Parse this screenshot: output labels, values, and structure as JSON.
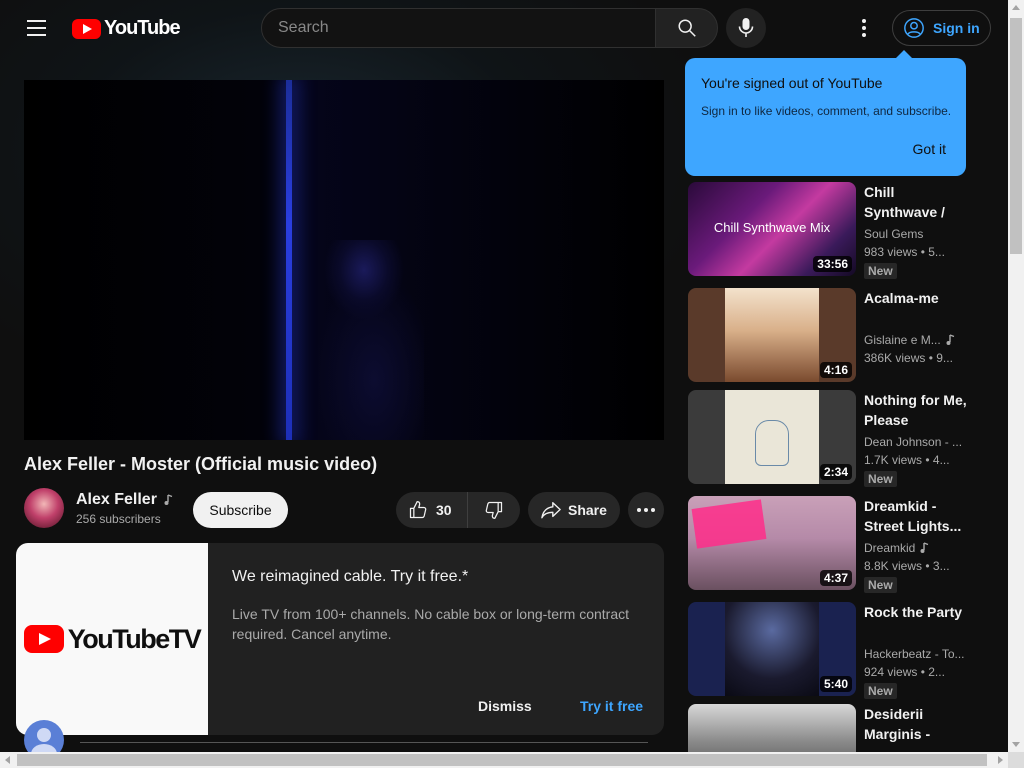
{
  "header": {
    "logo_text": "YouTube",
    "search_placeholder": "Search",
    "signin_label": "Sign in"
  },
  "video": {
    "title": "Alex Feller - Moster (Official music video)",
    "channel": "Alex Feller",
    "subscribers": "256 subscribers",
    "subscribe_label": "Subscribe",
    "likes": "30",
    "share_label": "Share"
  },
  "ad": {
    "brand": "YouTubeTV",
    "title": "We reimagined cable. Try it free.*",
    "description": "Live TV from 100+ channels. No cable box or long-term contract required. Cancel anytime.",
    "dismiss_label": "Dismiss",
    "cta_label": "Try it free"
  },
  "tooltip": {
    "title": "You're signed out of YouTube",
    "body": "Sign in to like videos, comment, and subscribe.",
    "button": "Got it"
  },
  "recommendations": [
    {
      "title": "Chill Synthwave / Electronic M...",
      "channel": "Soul Gems",
      "meta": "983 views • 5...",
      "badge": "New",
      "duration": "33:56",
      "thumb_text": "Chill Synthwave Mix",
      "music_icon": false
    },
    {
      "title": "Acalma-me",
      "channel": "Gislaine e M...",
      "meta": "386K views • 9...",
      "badge": "",
      "duration": "4:16",
      "thumb_text": "",
      "music_icon": true
    },
    {
      "title": "Nothing for Me, Please",
      "channel": "Dean Johnson - ...",
      "meta": "1.7K views • 4...",
      "badge": "New",
      "duration": "2:34",
      "thumb_text": "",
      "music_icon": false
    },
    {
      "title": "Dreamkid - Street Lights...",
      "channel": "Dreamkid",
      "meta": "8.8K views • 3...",
      "badge": "New",
      "duration": "4:37",
      "thumb_text": "",
      "music_icon": true
    },
    {
      "title": "Rock the Party",
      "channel": "Hackerbeatz - To...",
      "meta": "924 views • 2...",
      "badge": "New",
      "duration": "5:40",
      "thumb_text": "",
      "music_icon": false
    },
    {
      "title": "Desiderii Marginis - The...",
      "channel": "",
      "meta": "",
      "badge": "",
      "duration": "",
      "thumb_text": "",
      "music_icon": false
    }
  ],
  "colors": {
    "background": "#0f0f0f",
    "accent_blue": "#3ea6ff",
    "brand_red": "#ff0000"
  }
}
